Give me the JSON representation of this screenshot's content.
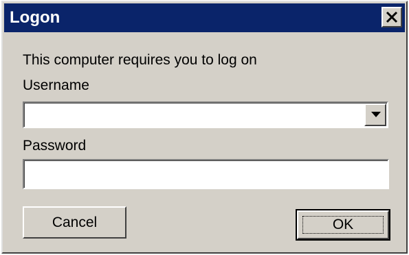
{
  "window": {
    "title": "Logon",
    "close_icon": "close-icon"
  },
  "form": {
    "message": "This computer requires you to log on",
    "username_label": "Username",
    "username_value": "",
    "password_label": "Password",
    "password_value": ""
  },
  "buttons": {
    "cancel_label": "Cancel",
    "ok_label": "OK"
  },
  "colors": {
    "titlebar": "#0a246a",
    "dialog_bg": "#d4d0c8"
  }
}
